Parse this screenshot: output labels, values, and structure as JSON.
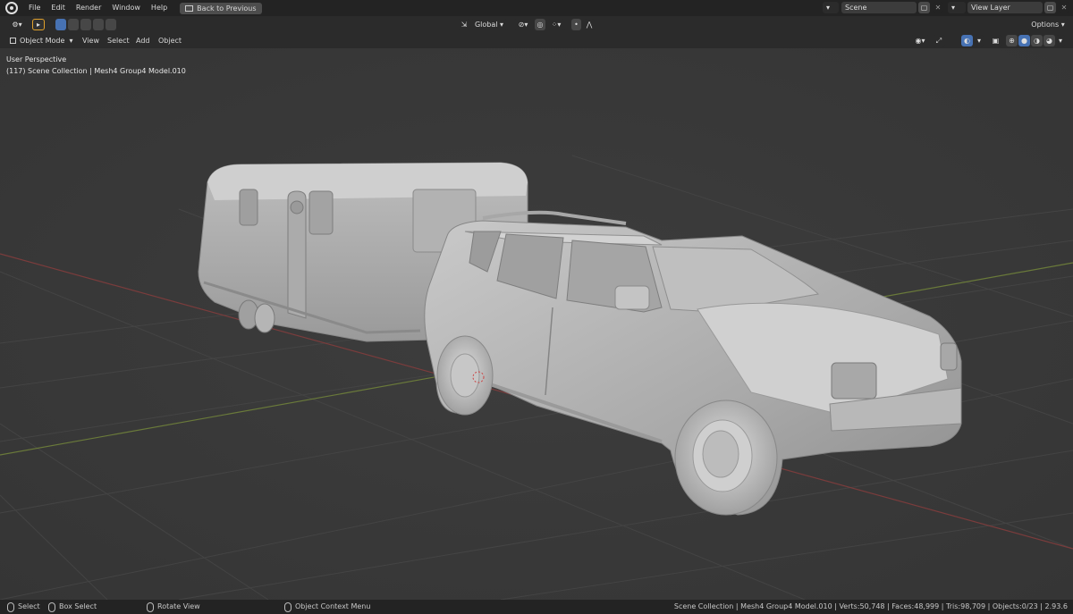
{
  "menu": {
    "file": "File",
    "edit": "Edit",
    "render": "Render",
    "window": "Window",
    "help": "Help"
  },
  "back_button": "Back to Previous",
  "scene_field": "Scene",
  "view_layer_field": "View Layer",
  "toolbar": {
    "transform_orientation": "Global",
    "options": "Options"
  },
  "header": {
    "mode": "Object Mode",
    "view": "View",
    "select": "Select",
    "add": "Add",
    "object": "Object"
  },
  "viewport": {
    "perspective": "User Perspective",
    "collection_info": "(117) Scene Collection | Mesh4 Group4 Model.010"
  },
  "status": {
    "select": "Select",
    "box_select": "Box Select",
    "rotate_view": "Rotate View",
    "context_menu": "Object Context Menu",
    "stats": "Scene Collection | Mesh4 Group4 Model.010 | Verts:50,748 | Faces:48,999 | Tris:98,709 | Objects:0/23 | 2.93.6"
  },
  "colors": {
    "accent": "#4772b3",
    "background": "#393939",
    "topbar": "#232323",
    "header": "#2b2b2b"
  }
}
